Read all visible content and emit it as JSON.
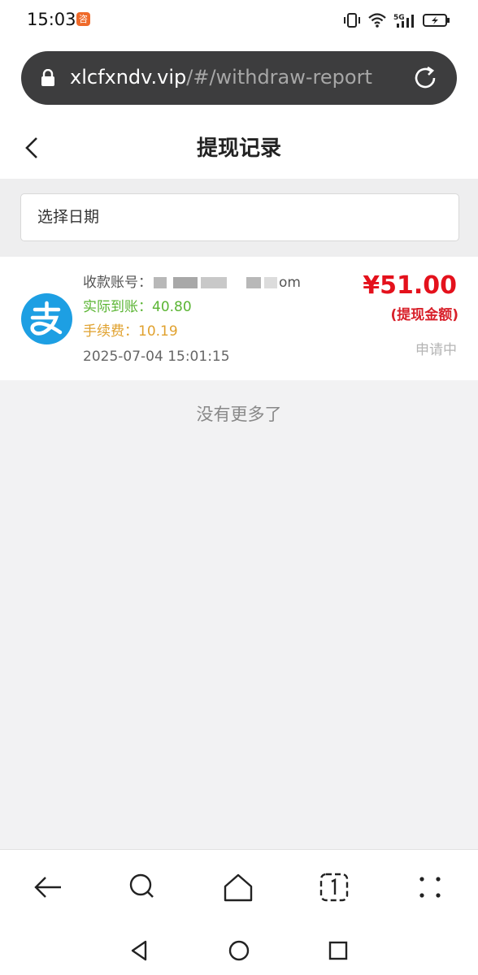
{
  "status_bar": {
    "time": "15:03",
    "app_icon_text": "咨",
    "network": "5G"
  },
  "browser": {
    "url_domain": "xlcfxndv.vip",
    "url_path": "/#/withdraw-report"
  },
  "header": {
    "title": "提现记录"
  },
  "filter": {
    "date_placeholder": "选择日期"
  },
  "records": [
    {
      "account_label": "收款账号：",
      "account_prefix": "",
      "account_suffix": "om",
      "actual_label": "实际到账：",
      "actual_value": "40.80",
      "fee_label": "手续费：",
      "fee_value": "10.19",
      "time": "2025-07-04 15:01:15",
      "amount": "¥51.00",
      "amount_label": "(提现金额)",
      "status": "申请中",
      "channel_icon": "alipay-icon"
    }
  ],
  "list_footer": "没有更多了",
  "colors": {
    "amount_red": "#e4111c",
    "actual_green": "#5bb534",
    "fee_orange": "#e0a12e",
    "alipay_blue": "#1d9fe3"
  }
}
